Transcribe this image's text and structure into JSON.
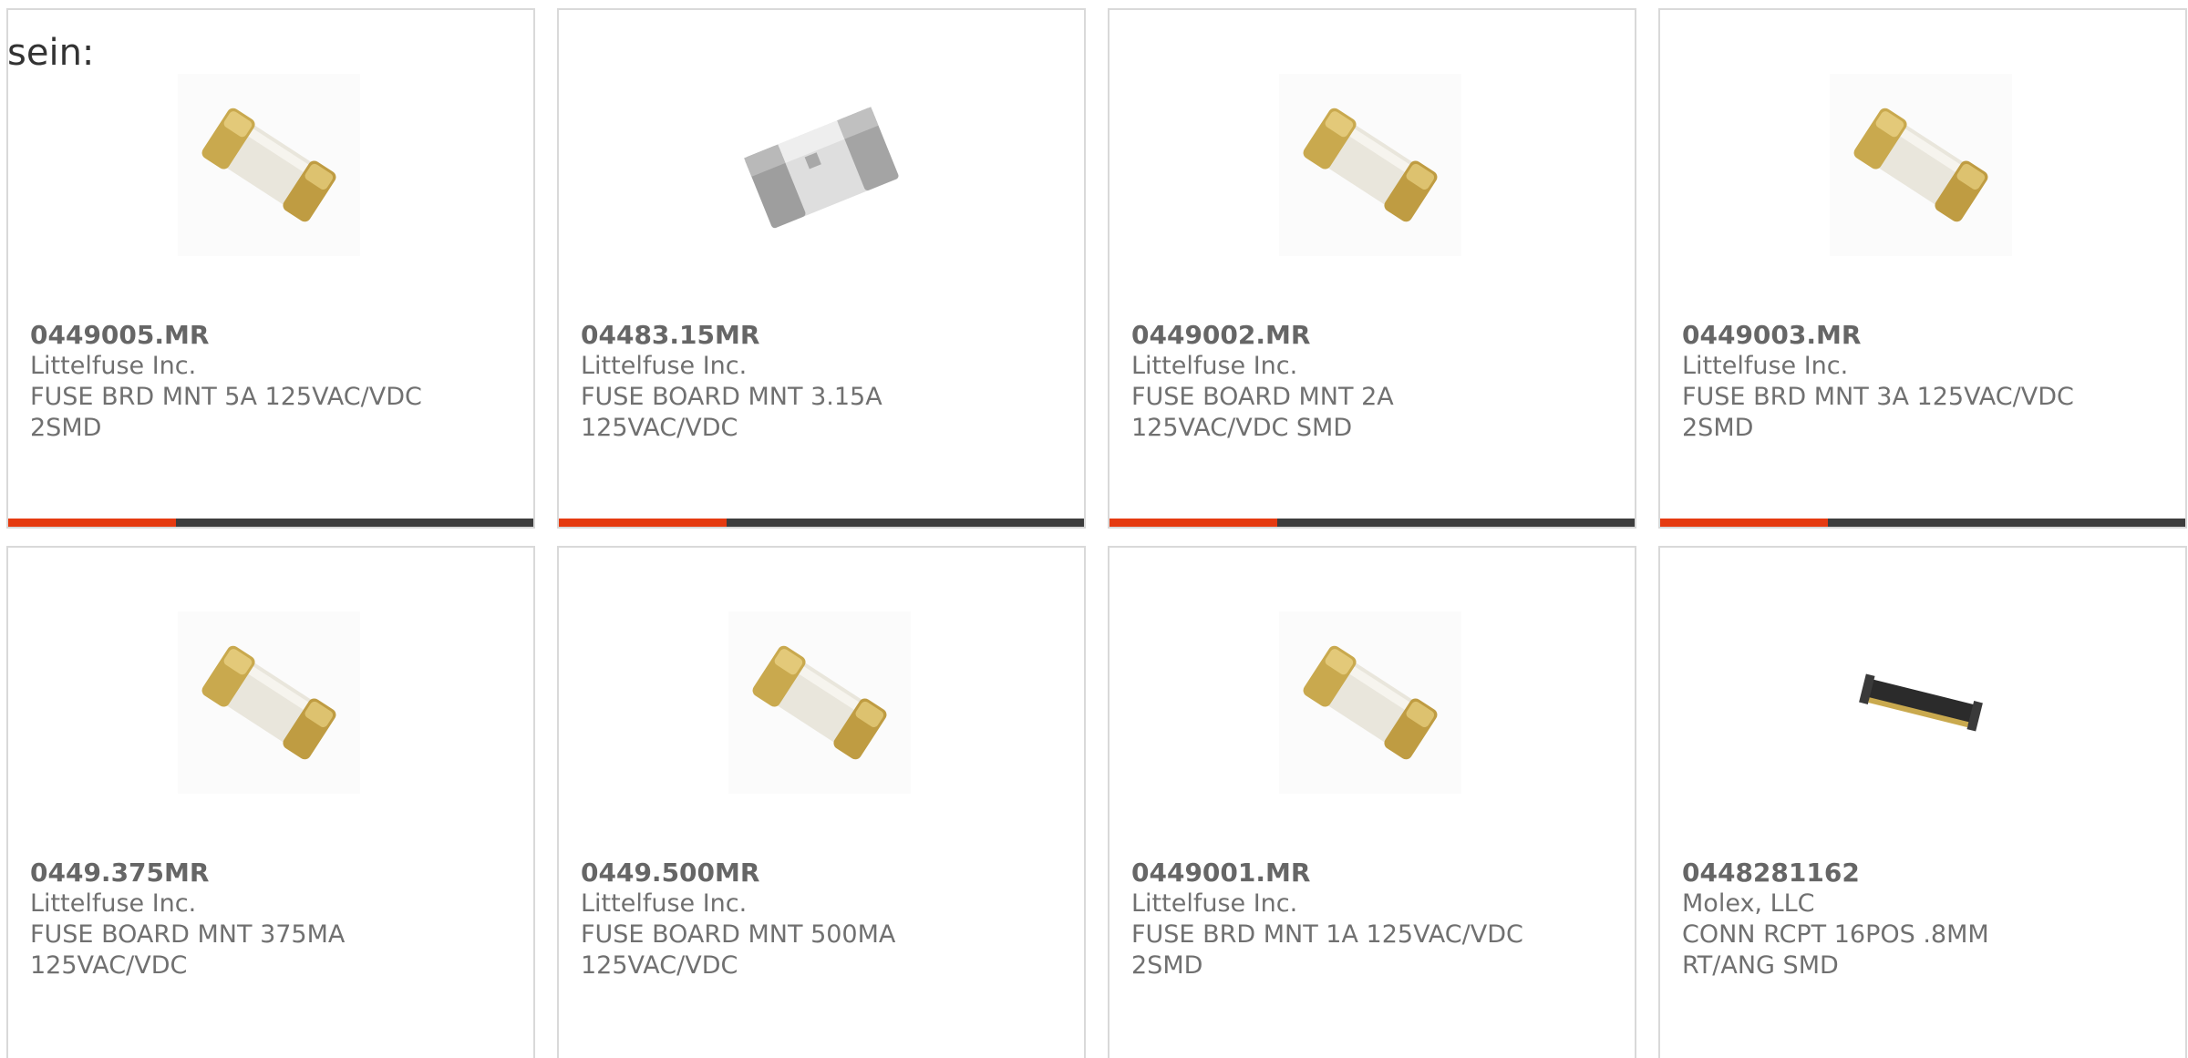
{
  "intro_text": "sein:",
  "colors": {
    "progress_fill": "#e53a10",
    "progress_track": "#3d3d3d",
    "card_border": "#d9d9d9",
    "text": "#707070"
  },
  "products": [
    {
      "part_number": "0449005.MR",
      "manufacturer": "Littelfuse Inc.",
      "description": "FUSE BRD MNT 5A 125VAC/VDC 2SMD",
      "image": "fuse-gold-icon",
      "progress": 0.32
    },
    {
      "part_number": "04483.15MR",
      "manufacturer": "Littelfuse Inc.",
      "description": "FUSE BOARD MNT 3.15A 125VAC/VDC",
      "image": "fuse-gray-icon",
      "progress": 0.32
    },
    {
      "part_number": "0449002.MR",
      "manufacturer": "Littelfuse Inc.",
      "description": "FUSE BOARD MNT 2A 125VAC/VDC SMD",
      "image": "fuse-gold-icon",
      "progress": 0.32
    },
    {
      "part_number": "0449003.MR",
      "manufacturer": "Littelfuse Inc.",
      "description": "FUSE BRD MNT 3A 125VAC/VDC 2SMD",
      "image": "fuse-gold-icon",
      "progress": 0.32
    },
    {
      "part_number": "0449.375MR",
      "manufacturer": "Littelfuse Inc.",
      "description": "FUSE BOARD MNT 375MA 125VAC/VDC",
      "image": "fuse-gold-icon"
    },
    {
      "part_number": "0449.500MR",
      "manufacturer": "Littelfuse Inc.",
      "description": "FUSE BOARD MNT 500MA 125VAC/VDC",
      "image": "fuse-gold-icon"
    },
    {
      "part_number": "0449001.MR",
      "manufacturer": "Littelfuse Inc.",
      "description": "FUSE BRD MNT 1A 125VAC/VDC 2SMD",
      "image": "fuse-gold-icon"
    },
    {
      "part_number": "0448281162",
      "manufacturer": "Molex, LLC",
      "description": "CONN RCPT 16POS .8MM RT/ANG SMD",
      "image": "connector-icon"
    }
  ]
}
